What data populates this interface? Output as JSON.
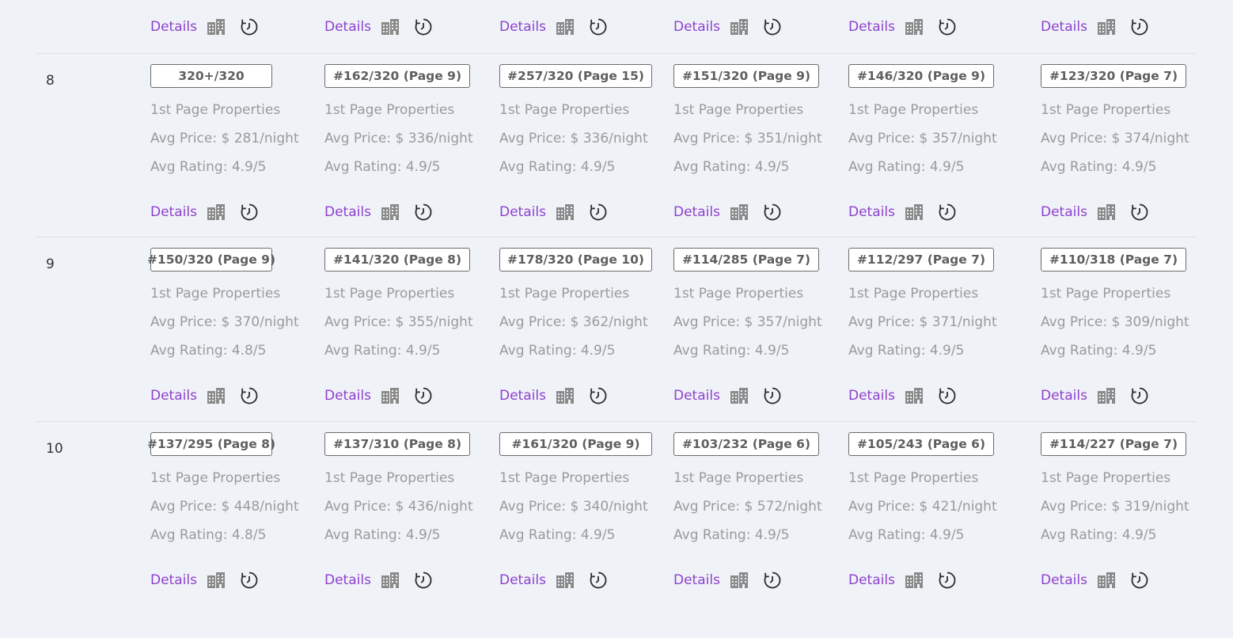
{
  "labels": {
    "details": "Details",
    "first_page": "1st Page Properties",
    "icons": {
      "building": "building-icon",
      "history": "history-clock-icon"
    }
  },
  "colors": {
    "link": "#8e3fcf",
    "muted": "#9a9a9a",
    "background": "#eff3f7"
  },
  "top_row": {
    "cells": 6
  },
  "rows": [
    {
      "number": "8",
      "cells": [
        {
          "rank": "320+/320",
          "price": "Avg Price: $ 281/night",
          "rating": "Avg Rating: 4.9/5"
        },
        {
          "rank": "#162/320 (Page 9)",
          "price": "Avg Price: $ 336/night",
          "rating": "Avg Rating: 4.9/5"
        },
        {
          "rank": "#257/320 (Page 15)",
          "price": "Avg Price: $ 336/night",
          "rating": "Avg Rating: 4.9/5"
        },
        {
          "rank": "#151/320 (Page 9)",
          "price": "Avg Price: $ 351/night",
          "rating": "Avg Rating: 4.9/5"
        },
        {
          "rank": "#146/320 (Page 9)",
          "price": "Avg Price: $ 357/night",
          "rating": "Avg Rating: 4.9/5"
        },
        {
          "rank": "#123/320 (Page 7)",
          "price": "Avg Price: $ 374/night",
          "rating": "Avg Rating: 4.9/5"
        }
      ]
    },
    {
      "number": "9",
      "cells": [
        {
          "rank": "#150/320 (Page 9)",
          "price": "Avg Price: $ 370/night",
          "rating": "Avg Rating: 4.8/5"
        },
        {
          "rank": "#141/320 (Page 8)",
          "price": "Avg Price: $ 355/night",
          "rating": "Avg Rating: 4.9/5"
        },
        {
          "rank": "#178/320 (Page 10)",
          "price": "Avg Price: $ 362/night",
          "rating": "Avg Rating: 4.9/5"
        },
        {
          "rank": "#114/285 (Page 7)",
          "price": "Avg Price: $ 357/night",
          "rating": "Avg Rating: 4.9/5"
        },
        {
          "rank": "#112/297 (Page 7)",
          "price": "Avg Price: $ 371/night",
          "rating": "Avg Rating: 4.9/5"
        },
        {
          "rank": "#110/318 (Page 7)",
          "price": "Avg Price: $ 309/night",
          "rating": "Avg Rating: 4.9/5"
        }
      ]
    },
    {
      "number": "10",
      "cells": [
        {
          "rank": "#137/295 (Page 8)",
          "price": "Avg Price: $ 448/night",
          "rating": "Avg Rating: 4.8/5"
        },
        {
          "rank": "#137/310 (Page 8)",
          "price": "Avg Price: $ 436/night",
          "rating": "Avg Rating: 4.9/5"
        },
        {
          "rank": "#161/320 (Page 9)",
          "price": "Avg Price: $ 340/night",
          "rating": "Avg Rating: 4.9/5"
        },
        {
          "rank": "#103/232 (Page 6)",
          "price": "Avg Price: $ 572/night",
          "rating": "Avg Rating: 4.9/5"
        },
        {
          "rank": "#105/243 (Page 6)",
          "price": "Avg Price: $ 421/night",
          "rating": "Avg Rating: 4.9/5"
        },
        {
          "rank": "#114/227 (Page 7)",
          "price": "Avg Price: $ 319/night",
          "rating": "Avg Rating: 4.9/5"
        }
      ]
    }
  ]
}
